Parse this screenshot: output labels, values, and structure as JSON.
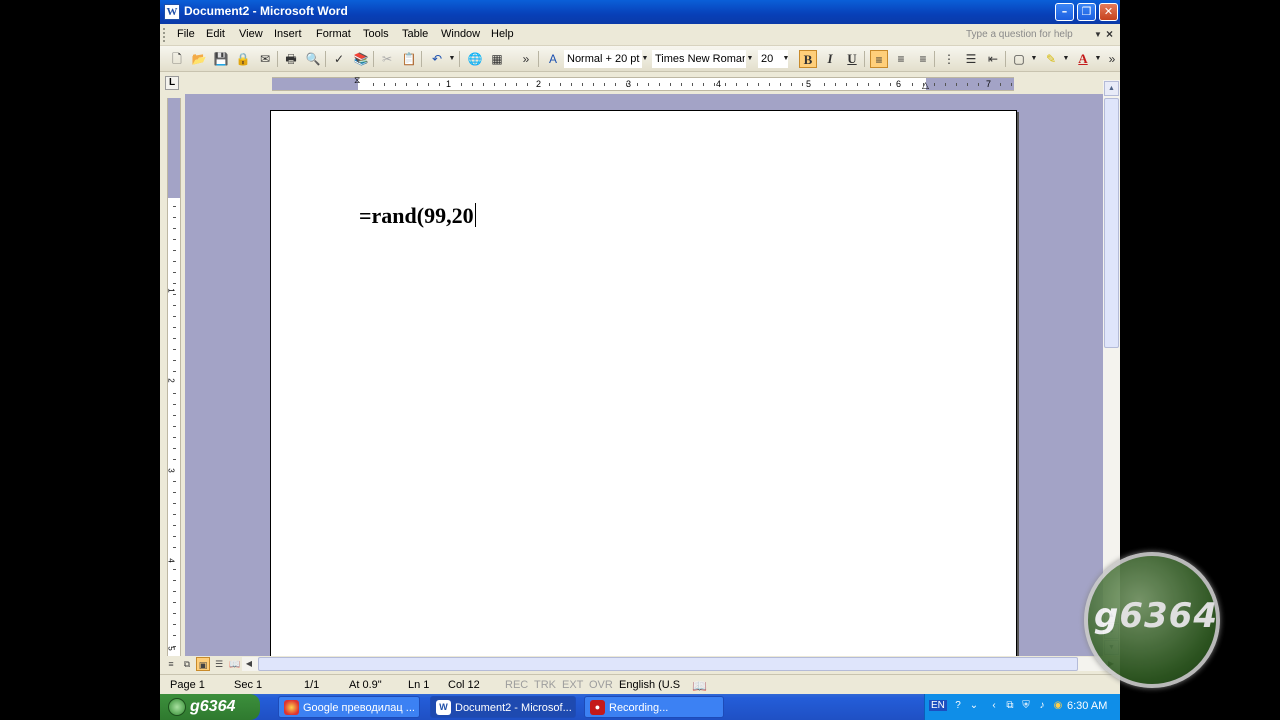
{
  "window": {
    "title": "Document2 - Microsoft Word",
    "app_icon": "W",
    "minimize_icon": "minimize-icon",
    "maximize_icon": "restore-icon",
    "close_icon": "close-icon"
  },
  "menubar": {
    "items": [
      "File",
      "Edit",
      "View",
      "Insert",
      "Format",
      "Tools",
      "Table",
      "Window",
      "Help"
    ],
    "help_placeholder": "Type a question for help"
  },
  "toolbar": {
    "style": "Normal + 20 pt",
    "font": "Times New Roman",
    "font_size": "20",
    "bold_label": "B",
    "italic_label": "I",
    "underline_label": "U",
    "font_color_label": "A"
  },
  "ruler": {
    "numbers": [
      "1",
      "2",
      "3",
      "4",
      "5",
      "6",
      "7"
    ],
    "vertical_numbers": [
      "1",
      "2",
      "3",
      "4",
      "5"
    ],
    "tab_selector": "L"
  },
  "document": {
    "text": "=rand(99,20"
  },
  "statusbar": {
    "page": "Page 1",
    "sec": "Sec 1",
    "page_of": "1/1",
    "at": "At 0.9\"",
    "ln": "Ln 1",
    "col": "Col 12",
    "rec": "REC",
    "trk": "TRK",
    "ext": "EXT",
    "ovr": "OVR",
    "language": "English (U.S"
  },
  "taskbar": {
    "start_label": "g6364",
    "tasks": [
      "Google преводилац ...",
      "Document2 - Microsof...",
      "Recording..."
    ],
    "lang": "EN",
    "clock": "6:30 AM"
  },
  "watermark": {
    "text": "g6364"
  },
  "colors": {
    "title_bar": "#0a5fd8",
    "app_bg": "#ece9d8",
    "doc_bg": "#a3a3c6",
    "active_button": "#ffcf7a",
    "taskbar": "#245dd8"
  }
}
